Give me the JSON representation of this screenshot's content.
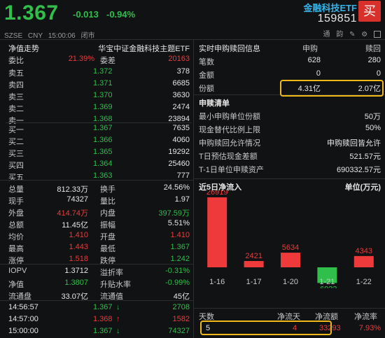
{
  "header": {
    "price": "1.367",
    "change": "-0.013",
    "change_pct": "-0.94%",
    "etf_name": "金融科技ETF",
    "etf_code": "159851",
    "buy_label": "买",
    "exchange": "SZSE",
    "currency": "CNY",
    "time": "15:00:06",
    "status": "闭市",
    "icon_labels": [
      "通",
      "韵"
    ]
  },
  "left": {
    "title": "净值走势",
    "fund_full_name": "华宝中证金融科技主题ETF",
    "weibi_label": "委比",
    "weibi_value": "21.39%",
    "weicha_label": "委差",
    "weicha_value": "20163",
    "asks": [
      {
        "label": "卖五",
        "price": "1.372",
        "volume": "378"
      },
      {
        "label": "卖四",
        "price": "1.371",
        "volume": "6685"
      },
      {
        "label": "卖三",
        "price": "1.370",
        "volume": "3630"
      },
      {
        "label": "卖二",
        "price": "1.369",
        "volume": "2474"
      },
      {
        "label": "卖一",
        "price": "1.368",
        "volume": "23894"
      }
    ],
    "bids": [
      {
        "label": "买一",
        "price": "1.367",
        "volume": "7635"
      },
      {
        "label": "买二",
        "price": "1.366",
        "volume": "4060"
      },
      {
        "label": "买三",
        "price": "1.365",
        "volume": "19292"
      },
      {
        "label": "买四",
        "price": "1.364",
        "volume": "25460"
      },
      {
        "label": "买五",
        "price": "1.363",
        "volume": "777"
      }
    ],
    "stats": [
      {
        "l1": "总量",
        "v1": "812.33万",
        "c1": "white",
        "l2": "换手",
        "v2": "24.56%",
        "c2": "white"
      },
      {
        "l1": "现手",
        "v1": "74327",
        "c1": "white",
        "l2": "量比",
        "v2": "1.97",
        "c2": "white"
      },
      {
        "l1": "外盘",
        "v1": "414.74万",
        "c1": "red",
        "l2": "内盘",
        "v2": "397.59万",
        "c2": "green"
      },
      {
        "l1": "总额",
        "v1": "11.45亿",
        "c1": "white",
        "l2": "振幅",
        "v2": "5.51%",
        "c2": "white"
      },
      {
        "l1": "均价",
        "v1": "1.410",
        "c1": "red",
        "l2": "开盘",
        "v2": "1.410",
        "c2": "red"
      },
      {
        "l1": "最高",
        "v1": "1.443",
        "c1": "red",
        "l2": "最低",
        "v2": "1.367",
        "c2": "green"
      },
      {
        "l1": "涨停",
        "v1": "1.518",
        "c1": "red",
        "l2": "跌停",
        "v2": "1.242",
        "c2": "green"
      }
    ],
    "stats2": [
      {
        "l1": "IOPV",
        "v1": "1.3712",
        "c1": "white",
        "l2": "溢折率",
        "v2": "-0.31%",
        "c2": "green"
      },
      {
        "l1": "净值",
        "v1": "1.3807",
        "c1": "green",
        "l2": "升贴水率",
        "v2": "-0.99%",
        "c2": "green"
      },
      {
        "l1": "流通盘",
        "v1": "33.07亿",
        "c1": "white",
        "l2": "流通值",
        "v2": "45亿",
        "c2": "white"
      }
    ],
    "ticks": [
      {
        "time": "14:56:57",
        "price": "1.367",
        "dir": "down",
        "vol": "2708",
        "vcolor": "green"
      },
      {
        "time": "14:57:00",
        "price": "1.368",
        "dir": "up",
        "vol": "1582",
        "vcolor": "red"
      },
      {
        "time": "15:00:00",
        "price": "1.367",
        "dir": "down",
        "vol": "74327",
        "vcolor": "green"
      }
    ]
  },
  "right": {
    "sg_title": "实时申购赎回信息",
    "col_sg": "申购",
    "col_sh": "赎回",
    "rows": [
      {
        "label": "笔数",
        "sg": "628",
        "sh": "280"
      },
      {
        "label": "金额",
        "sg": "0",
        "sh": "0"
      },
      {
        "label": "份额",
        "sg": "4.31亿",
        "sh": "2.07亿"
      }
    ],
    "list_title": "申赎清单",
    "list": [
      {
        "label": "最小申购单位份额",
        "value": "50万"
      },
      {
        "label": "现金替代比例上限",
        "value": "50%"
      },
      {
        "label": "申购赎回允许情况",
        "value": "申购赎回皆允许"
      },
      {
        "label": "T日预估现金差额",
        "value": "521.57元"
      },
      {
        "label": "T-1日单位申赎资产",
        "value": "690332.57元"
      }
    ],
    "flow_title": "近5日净流入",
    "flow_unit": "单位(万元)",
    "summary_headers": [
      "天数",
      "净流天",
      "净流额",
      "净流率"
    ],
    "summary_values": [
      "5",
      "4",
      "33293",
      "7.93%"
    ]
  },
  "chart_data": {
    "type": "bar",
    "categories": [
      "1-16",
      "1-17",
      "1-20",
      "1-21",
      "1-22"
    ],
    "values": [
      26919,
      2421,
      5634,
      -6023,
      4343
    ],
    "colors": {
      "positive": "#ee3a3a",
      "negative": "#2fbf4a"
    }
  },
  "colors": {
    "up": "#ee3a3a",
    "down": "#2fbf4a",
    "accent": "#36b3e8",
    "highlight": "#f0b819",
    "buy": "#d8312b"
  }
}
